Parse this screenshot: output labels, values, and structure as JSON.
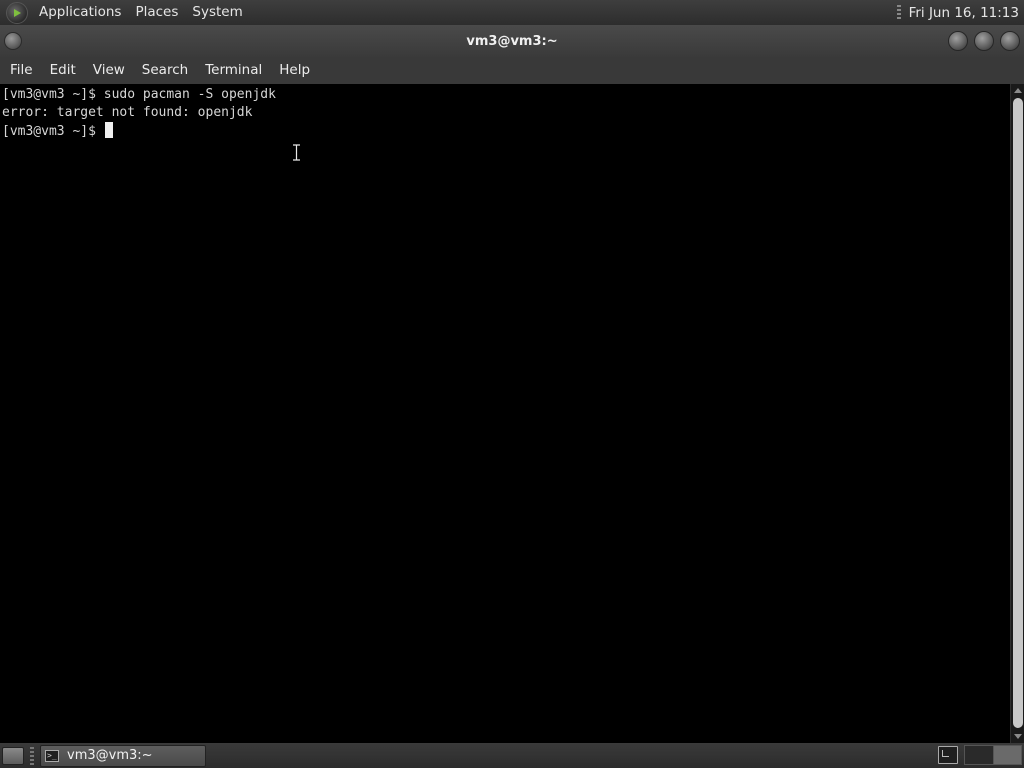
{
  "top_panel": {
    "menus": [
      "Applications",
      "Places",
      "System"
    ],
    "clock": "Fri Jun 16, 11:13"
  },
  "window": {
    "title": "vm3@vm3:~",
    "menus": [
      "File",
      "Edit",
      "View",
      "Search",
      "Terminal",
      "Help"
    ]
  },
  "terminal": {
    "lines": [
      "[vm3@vm3 ~]$ sudo pacman -S openjdk",
      "error: target not found: openjdk"
    ],
    "prompt": "[vm3@vm3 ~]$ "
  },
  "taskbar": {
    "tasks": [
      {
        "label": "vm3@vm3:~",
        "icon": "terminal-icon"
      }
    ],
    "active_workspace": 2
  },
  "colors": {
    "terminal_bg": "#000000",
    "terminal_fg": "#d6d6d6",
    "panel_bg": "#333333"
  }
}
